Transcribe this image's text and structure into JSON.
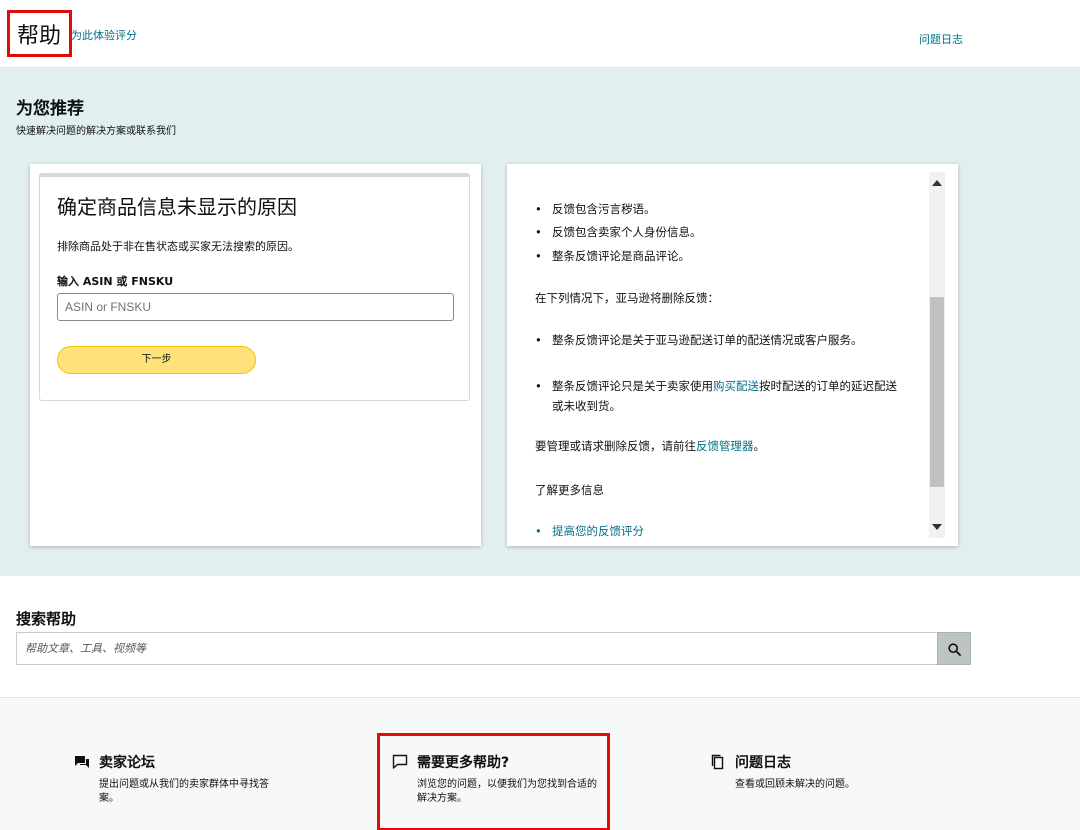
{
  "header": {
    "title": "帮助",
    "rate_link": "为此体验评分",
    "issue_log_link": "问题日志"
  },
  "recommend": {
    "title": "为您推荐",
    "subtitle": "快速解决问题的解决方案或联系我们",
    "left_card": {
      "title": "确定商品信息未显示的原因",
      "description": "排除商品处于非在售状态或买家无法搜索的原因。",
      "input_label": "输入 ASIN 或 FNSKU",
      "input_placeholder": "ASIN or FNSKU",
      "input_value": "",
      "next_button": "下一步"
    },
    "right_card": {
      "bullets_top": [
        "反馈包含污言秽语。",
        "反馈包含卖家个人身份信息。",
        "整条反馈评论是商品评论。"
      ],
      "para_remove": "在下列情况下，亚马逊将删除反馈：",
      "bullet_delivery": "整条反馈评论是关于亚马逊配送订单的配送情况或客户服务。",
      "bullet_buy_pre": "整条反馈评论只是关于卖家使用",
      "bullet_buy_link": "购买配送",
      "bullet_buy_post": "按时配送的订单的延迟配送或未收到货。",
      "para_manage_pre": "要管理或请求删除反馈，请前往",
      "para_manage_link": "反馈管理器",
      "para_manage_post": "。",
      "learn_more": "了解更多信息",
      "bullet_improve": "提高您的反馈评分"
    }
  },
  "search": {
    "title": "搜索帮助",
    "placeholder": "帮助文章、工具、视频等",
    "value": ""
  },
  "footer": {
    "items": [
      {
        "title": "卖家论坛",
        "description": "提出问题或从我们的卖家群体中寻找答案。",
        "icon": "forum-icon"
      },
      {
        "title": "需要更多帮助?",
        "description": "浏览您的问题，以便我们为您找到合适的解决方案。",
        "icon": "chat-bubble-icon"
      },
      {
        "title": "问题日志",
        "description": "查看或回顾未解决的问题。",
        "icon": "copy-icon"
      }
    ]
  },
  "colors": {
    "link": "#007185",
    "reco_bg": "#e2eff0",
    "button_yellow": "#ffe37a",
    "highlight_red": "#e30a0a"
  }
}
